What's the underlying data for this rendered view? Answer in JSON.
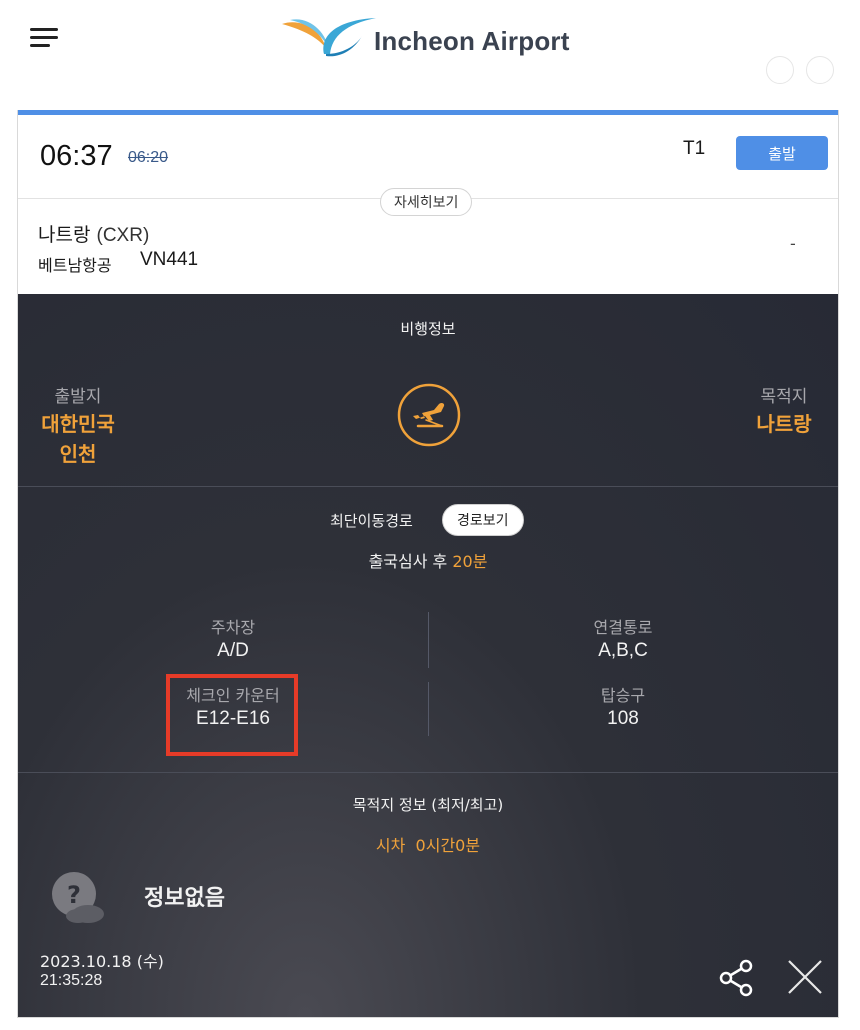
{
  "header": {
    "logo_text": "Incheon Airport"
  },
  "flight": {
    "time": "06:37",
    "scheduled_time": "06:20",
    "terminal": "T1",
    "status": "출발",
    "detail_button": "자세히보기",
    "destination": "나트랑",
    "destination_code": "(CXR)",
    "airline": "베트남항공",
    "flight_number": "VN441",
    "extra": "-"
  },
  "flight_info": {
    "title": "비행정보",
    "origin_label": "출발지",
    "origin_country": "대한민국",
    "origin_city": "인천",
    "dest_label": "목적지",
    "dest_city": "나트랑"
  },
  "route": {
    "title": "최단이동경로",
    "button": "경로보기",
    "immigration_prefix": "출국심사 후 ",
    "immigration_time": "20분",
    "parking_label": "주차장",
    "parking_value": "A/D",
    "connection_label": "연결통로",
    "connection_value": "A,B,C",
    "checkin_label": "체크인 카운터",
    "checkin_value": "E12-E16",
    "gate_label": "탑승구",
    "gate_value": "108"
  },
  "destination_info": {
    "title": "목적지 정보 (최저/최고)",
    "timediff_label": "시차",
    "timediff_value": "0시간0분",
    "weather": "정보없음"
  },
  "footer": {
    "date": "2023.10.18 (수)",
    "time": "21:35:28"
  },
  "colors": {
    "accent": "#4f8fe6",
    "orange": "#f0a23a",
    "highlight": "#e63b28",
    "dark_bg": "#2e3038"
  }
}
